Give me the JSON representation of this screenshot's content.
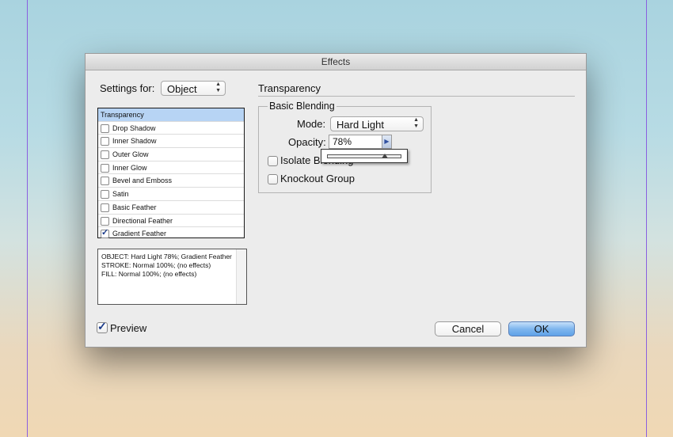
{
  "window": {
    "title": "Effects"
  },
  "settings_for": {
    "label": "Settings for:",
    "value": "Object"
  },
  "effects_list": [
    {
      "label": "Transparency",
      "checked": false,
      "selected": true
    },
    {
      "label": "Drop Shadow",
      "checked": false
    },
    {
      "label": "Inner Shadow",
      "checked": false
    },
    {
      "label": "Outer Glow",
      "checked": false
    },
    {
      "label": "Inner Glow",
      "checked": false
    },
    {
      "label": "Bevel and Emboss",
      "checked": false
    },
    {
      "label": "Satin",
      "checked": false
    },
    {
      "label": "Basic Feather",
      "checked": false
    },
    {
      "label": "Directional Feather",
      "checked": false
    },
    {
      "label": "Gradient Feather",
      "checked": true
    }
  ],
  "summary": {
    "lines": [
      "OBJECT: Hard Light 78%; Gradient Feather",
      "STROKE: Normal 100%; (no effects)",
      "FILL: Normal 100%; (no effects)"
    ]
  },
  "transparency": {
    "section_title": "Transparency",
    "group_title": "Basic Blending",
    "mode_label": "Mode:",
    "mode_value": "Hard Light",
    "opacity_label": "Opacity:",
    "opacity_value": "78%",
    "opacity_fraction": 0.78,
    "isolate_label": "Isolate Blending",
    "knockout_label": "Knockout Group"
  },
  "footer": {
    "preview_label": "Preview",
    "preview_checked": true,
    "cancel_label": "Cancel",
    "ok_label": "OK"
  },
  "colors": {
    "accent": "#6fabea",
    "selection": "#b7d4f4",
    "guide": "#8a5fe0"
  },
  "icons": {
    "checkmark": "check-icon",
    "popup_arrows": "updown-arrows-icon",
    "stepper": "triangle-right-icon"
  }
}
